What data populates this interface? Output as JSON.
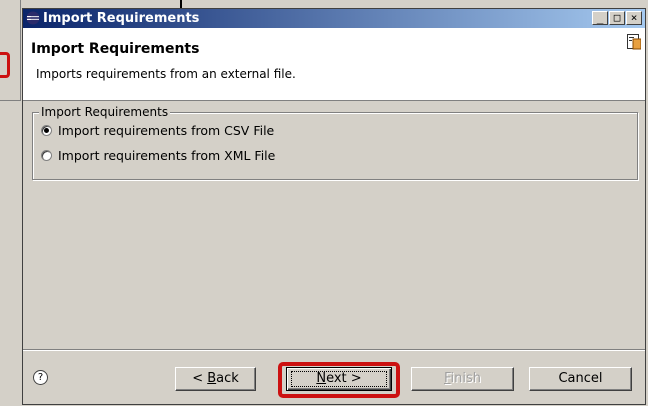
{
  "window": {
    "title": "Import Requirements"
  },
  "titlebar_buttons": {
    "minimize": "_",
    "maximize": "□",
    "close": "×"
  },
  "header": {
    "title": "Import Requirements",
    "description": "Imports requirements from an external file."
  },
  "group": {
    "label": "Import Requirements",
    "options": [
      {
        "label": "Import requirements from CSV File",
        "selected": true
      },
      {
        "label": "Import requirements from XML File",
        "selected": false
      }
    ]
  },
  "buttons": {
    "help": "?",
    "back": {
      "prefix": "< ",
      "mnemonic": "B",
      "rest": "ack"
    },
    "next": {
      "mnemonic": "N",
      "rest": "ext >"
    },
    "finish": {
      "mnemonic": "F",
      "rest": "inish"
    },
    "cancel": "Cancel"
  },
  "colors": {
    "highlight": "#cc1111",
    "titlebar_start": "#0a246a",
    "titlebar_end": "#a6caf0"
  }
}
